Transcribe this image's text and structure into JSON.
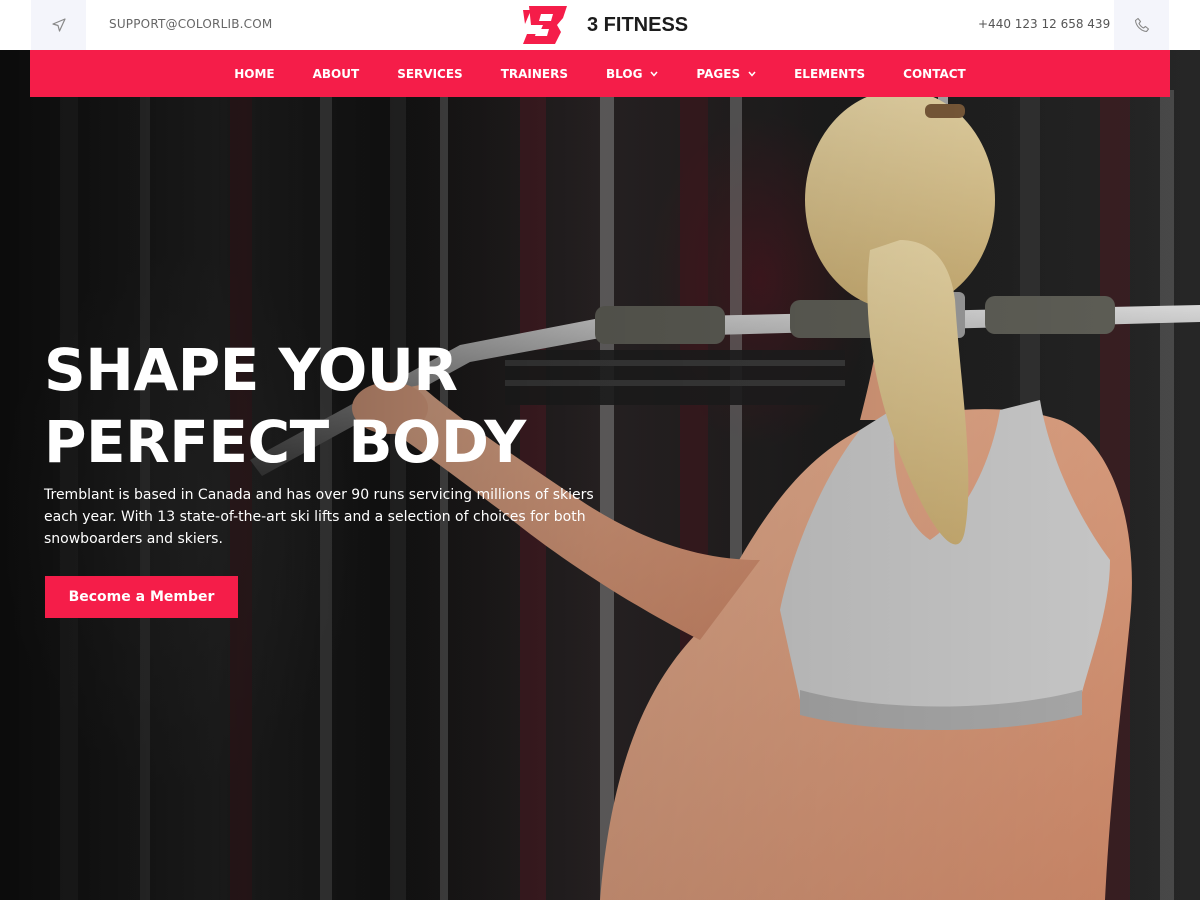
{
  "topbar": {
    "support_email": "SUPPORT@COLORLIB.COM",
    "phone": "+440 123 12 658 439",
    "logo_text": "3 FITNESS",
    "icons": {
      "left": "navigation-arrow-icon",
      "right": "phone-icon"
    }
  },
  "nav": {
    "items": [
      {
        "label": "HOME"
      },
      {
        "label": "ABOUT"
      },
      {
        "label": "SERVICES"
      },
      {
        "label": "TRAINERS"
      },
      {
        "label": "BLOG",
        "dropdown": true
      },
      {
        "label": "PAGES",
        "dropdown": true
      },
      {
        "label": "ELEMENTS"
      },
      {
        "label": "CONTACT"
      }
    ]
  },
  "hero": {
    "headline_line1": "SHAPE YOUR",
    "headline_line2": "PERFECT BODY",
    "description": "Tremblant is based in Canada and has over 90 runs servicing millions of skiers each year. With 13 state-of-the-art ski lifts and a selection of choices for both snowboarders and skiers.",
    "cta_label": "Become a Member"
  },
  "colors": {
    "accent": "#f51d49",
    "topbar_bg": "#ffffff",
    "icon_box_bg": "#f4f5fb",
    "text_dark": "#1c1c1c"
  }
}
